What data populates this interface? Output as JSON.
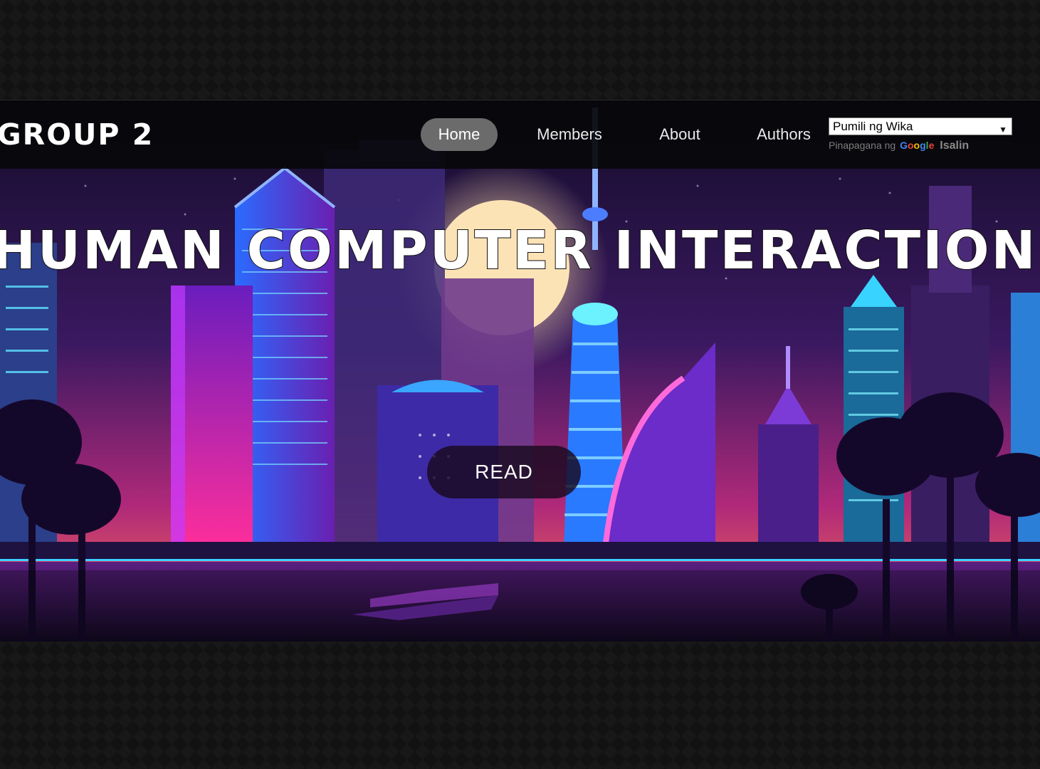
{
  "navbar": {
    "logo": "GROUP 2",
    "items": [
      {
        "label": "Home",
        "active": true
      },
      {
        "label": "Members",
        "active": false
      },
      {
        "label": "About",
        "active": false
      },
      {
        "label": "Authors",
        "active": false
      }
    ]
  },
  "translate": {
    "selected": "Pumili ng Wika",
    "powered_prefix": "Pinapagana ng",
    "powered_brand": "Google",
    "powered_action": "Isalin"
  },
  "hero": {
    "title": "HUMAN COMPUTER INTERACTION",
    "button": "READ"
  },
  "colors": {
    "accent_pink": "#ff2fa8",
    "accent_cyan": "#28d9ff",
    "accent_purple": "#6b2cff",
    "moon": "#fde7b8"
  }
}
